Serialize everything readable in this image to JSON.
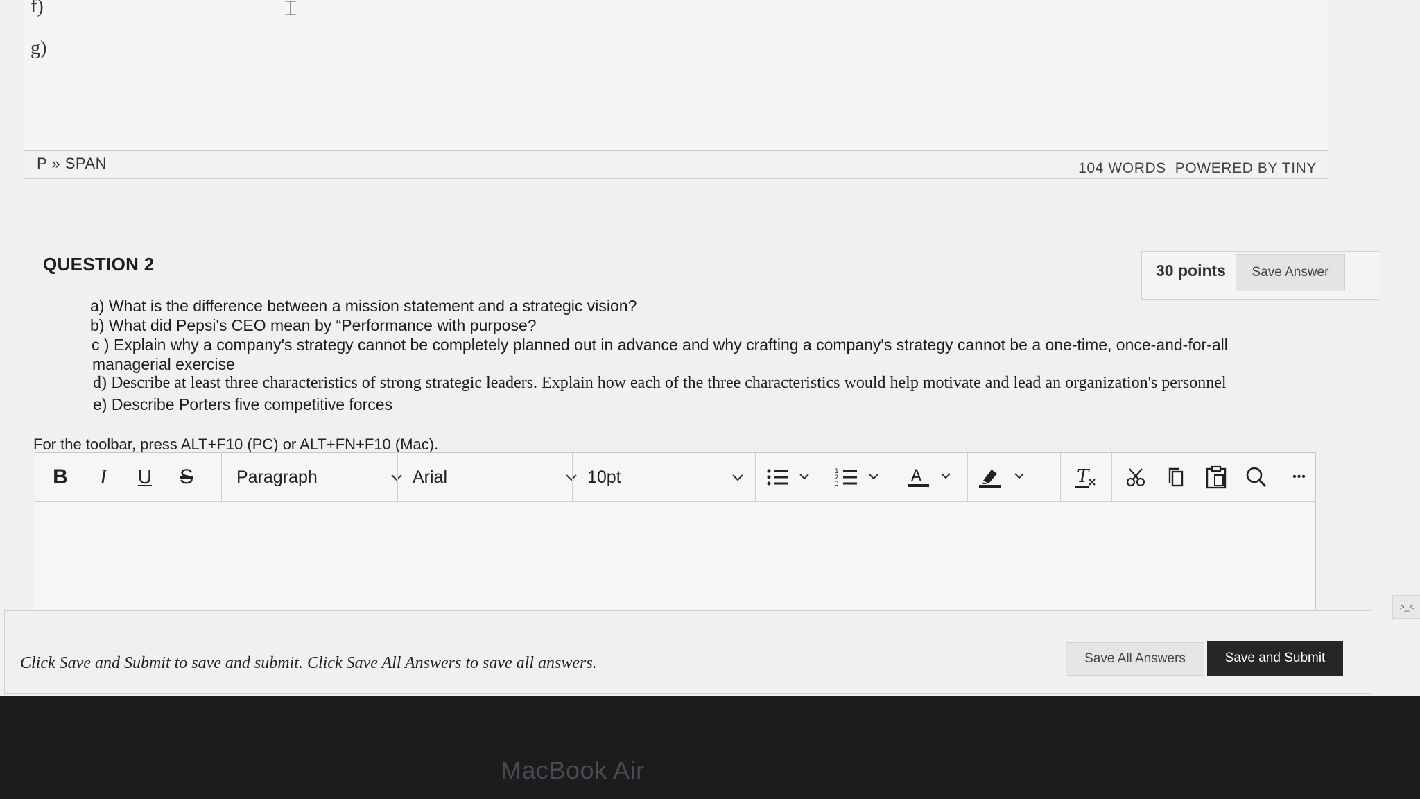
{
  "previous_editor": {
    "lines": [
      "f)",
      "g)"
    ],
    "element_path": "P » SPAN",
    "word_count": "104 WORDS",
    "powered_by": "POWERED BY TINY"
  },
  "question": {
    "title": "QUESTION 2",
    "points": "30 points",
    "save_answer_label": "Save Answer",
    "prompt_lines": [
      "a) What is the difference between a mission statement and a strategic vision?",
      "b) What did Pepsi's CEO mean by “Performance with purpose?",
      "c ) Explain why a company's strategy cannot be completely planned out in advance and why crafting a company's strategy cannot be a one-time, once-and-for-all",
      "managerial exercise",
      "d) Describe at least three characteristics of strong strategic leaders. Explain how each of the three characteristics would help motivate and lead an organization's personnel",
      "e) Describe Porters five competitive forces"
    ]
  },
  "editor": {
    "toolbar_hint": "For the toolbar, press ALT+F10 (PC) or ALT+FN+F10 (Mac).",
    "block_format": "Paragraph",
    "font_family": "Arial",
    "font_size": "10pt",
    "buttons": {
      "bold": "B",
      "italic": "I",
      "underline": "U",
      "strikethrough": "S",
      "more": "•••"
    }
  },
  "footer": {
    "instruction": "Click Save and Submit to save and submit. Click Save All Answers to save all answers.",
    "save_all_label": "Save All Answers",
    "submit_label": "Save and Submit"
  },
  "device": {
    "bezel_label": "MacBook Air"
  },
  "side_handle": ">_<"
}
